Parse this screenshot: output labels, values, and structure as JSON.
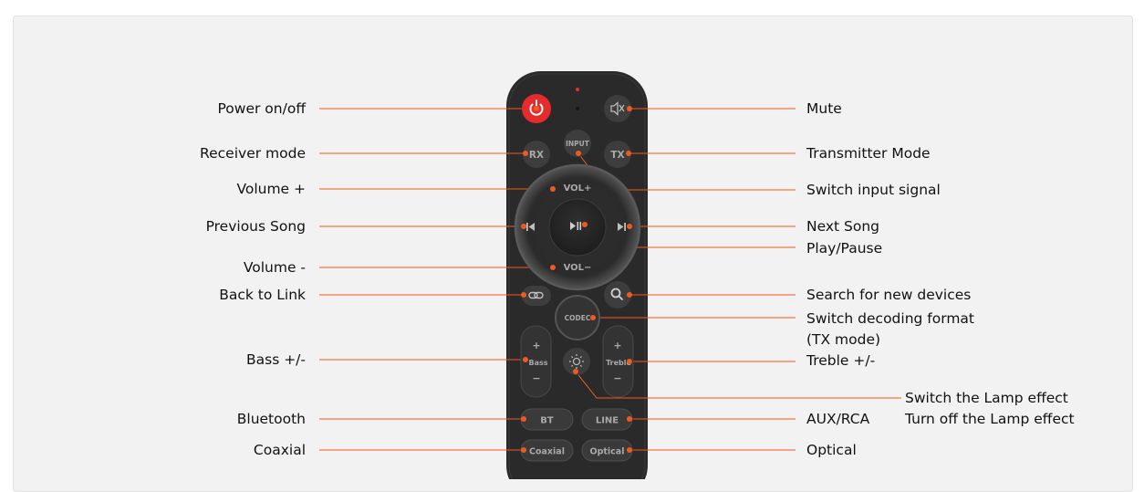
{
  "colors": {
    "accent": "#f05a22",
    "remote_body": "#2a2a2a",
    "button": "#3a3a3a",
    "power_button": "#e52b2b"
  },
  "remote": {
    "buttons": {
      "input": "INPUT",
      "rx": "RX",
      "tx": "TX",
      "vol_plus": "VOL+",
      "vol_minus": "VOL−",
      "codec": "CODEC",
      "bass": "Bass",
      "treble": "Treble",
      "plus": "+",
      "minus": "−",
      "bt": "BT",
      "line": "LINE",
      "coaxial": "Coaxial",
      "optical": "Optical"
    },
    "icons": [
      "power-icon",
      "mute-icon",
      "previous-icon",
      "play-pause-icon",
      "next-icon",
      "link-icon",
      "search-icon",
      "lamp-icon"
    ]
  },
  "labels": {
    "left": {
      "power": "Power on/off",
      "receiver": "Receiver mode",
      "volume_up": "Volume +",
      "previous": "Previous Song",
      "volume_down": "Volume -",
      "back_link": "Back to Link",
      "bass": "Bass +/-",
      "bluetooth": "Bluetooth",
      "coaxial": "Coaxial"
    },
    "right": {
      "mute": "Mute",
      "transmitter": "Transmitter Mode",
      "switch_input": "Switch input signal",
      "next": "Next Song",
      "play_pause": "Play/Pause",
      "search": "Search for new devices",
      "decoding_line1": "Switch decoding format",
      "decoding_line2": "(TX mode)",
      "treble": "Treble +/-",
      "lamp_switch": "Switch the Lamp effect",
      "lamp_off": "Turn off the Lamp effect",
      "aux": "AUX/RCA",
      "optical": "Optical"
    }
  }
}
